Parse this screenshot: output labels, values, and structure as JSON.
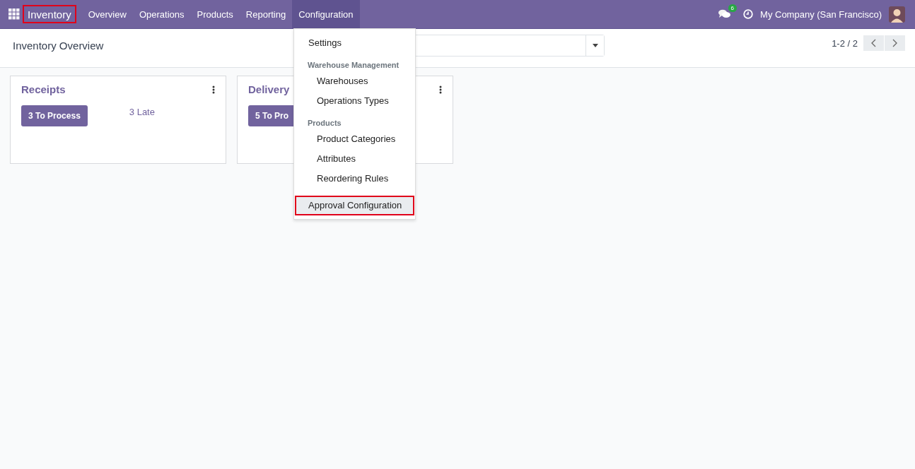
{
  "navbar": {
    "brand": {
      "label": "Inventory",
      "highlighted": true
    },
    "menus": [
      {
        "label": "Overview",
        "selected": false
      },
      {
        "label": "Operations",
        "selected": false
      },
      {
        "label": "Products",
        "selected": false
      },
      {
        "label": "Reporting",
        "selected": false
      },
      {
        "label": "Configuration",
        "selected": true
      }
    ],
    "messages_badge": "6",
    "company": "My Company (San Francisco)"
  },
  "control_panel": {
    "title": "Inventory Overview",
    "pager": "1-2 / 2"
  },
  "cards": [
    {
      "title": "Receipts",
      "button": "3 To Process",
      "late": "3 Late"
    },
    {
      "title": "Delivery",
      "button": "5 To Pro"
    }
  ],
  "dropdown": {
    "items": [
      {
        "kind": "item",
        "label": "Settings",
        "highlighted": false
      },
      {
        "kind": "header",
        "label": "Warehouse Management"
      },
      {
        "kind": "subitem",
        "label": "Warehouses",
        "highlighted": false
      },
      {
        "kind": "subitem",
        "label": "Operations Types",
        "highlighted": false
      },
      {
        "kind": "header",
        "label": "Products"
      },
      {
        "kind": "subitem",
        "label": "Product Categories",
        "highlighted": false
      },
      {
        "kind": "subitem",
        "label": "Attributes",
        "highlighted": false
      },
      {
        "kind": "subitem",
        "label": "Reordering Rules",
        "highlighted": false
      },
      {
        "kind": "item",
        "label": "Approval Configuration",
        "highlighted": true
      }
    ]
  }
}
